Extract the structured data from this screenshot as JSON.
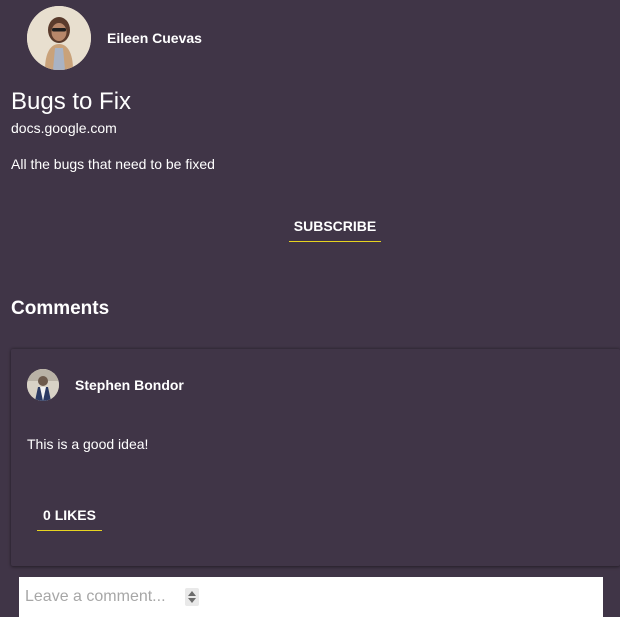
{
  "post": {
    "author_name": "Eileen Cuevas",
    "title": "Bugs to Fix",
    "domain": "docs.google.com",
    "description": "All the bugs that need to be fixed",
    "subscribe_label": "SUBSCRIBE"
  },
  "comments": {
    "heading": "Comments",
    "items": [
      {
        "author_name": "Stephen Bondor",
        "text": "This is a good idea!",
        "likes_label": "0 LIKES"
      }
    ],
    "input_placeholder": "Leave a comment..."
  },
  "colors": {
    "background": "#403547",
    "text": "#ffffff",
    "accent_underline": "#e6d320",
    "input_background": "#ffffff"
  },
  "icons": {
    "author_avatar": "author-avatar",
    "commenter_avatar": "commenter-avatar",
    "resize": "resize-handle-icon"
  }
}
